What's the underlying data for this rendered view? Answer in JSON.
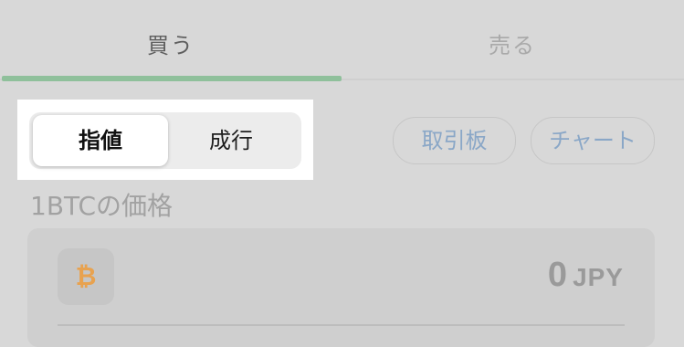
{
  "tabs": [
    {
      "label": "買う"
    },
    {
      "label": "売る"
    }
  ],
  "order_type": {
    "options": [
      "指値",
      "成行"
    ],
    "selected": "指値"
  },
  "actions": {
    "board_label": "取引板",
    "chart_label": "チャート"
  },
  "price": {
    "label": "1BTCの価格",
    "coin_icon": "bitcoin-icon",
    "value": "0",
    "unit": "JPY"
  },
  "colors": {
    "tab_indicator": "#8fc09b",
    "link_text": "#8aa7c7",
    "bitcoin": "#e8a24f"
  }
}
